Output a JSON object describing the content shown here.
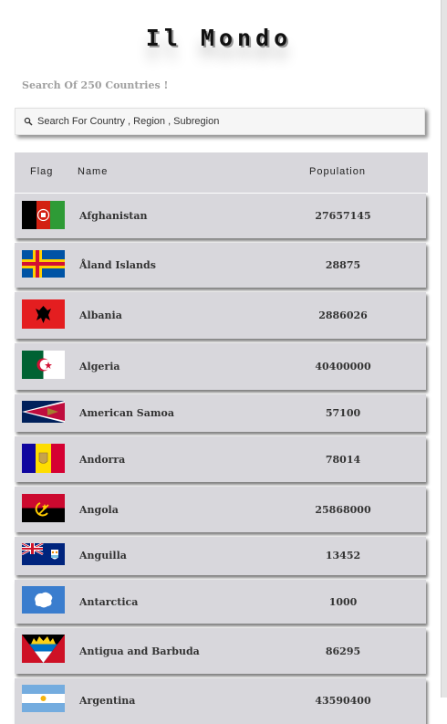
{
  "header": {
    "title": "Il Mondo",
    "subtitle": "Search Of 250 Countries !"
  },
  "search": {
    "placeholder": "Search For Country , Region , Subregion",
    "value": ""
  },
  "table": {
    "columns": [
      "Flag",
      "Name",
      "Population"
    ],
    "rows": [
      {
        "name": "Afghanistan",
        "population": "27657145",
        "flag": "afghanistan-flag"
      },
      {
        "name": "Åland Islands",
        "population": "28875",
        "flag": "aland-flag"
      },
      {
        "name": "Albania",
        "population": "2886026",
        "flag": "albania-flag"
      },
      {
        "name": "Algeria",
        "population": "40400000",
        "flag": "algeria-flag"
      },
      {
        "name": "American Samoa",
        "population": "57100",
        "flag": "american-samoa-flag"
      },
      {
        "name": "Andorra",
        "population": "78014",
        "flag": "andorra-flag"
      },
      {
        "name": "Angola",
        "population": "25868000",
        "flag": "angola-flag"
      },
      {
        "name": "Anguilla",
        "population": "13452",
        "flag": "anguilla-flag"
      },
      {
        "name": "Antarctica",
        "population": "1000",
        "flag": "antarctica-flag"
      },
      {
        "name": "Antigua and Barbuda",
        "population": "86295",
        "flag": "antigua-flag"
      },
      {
        "name": "Argentina",
        "population": "43590400",
        "flag": "argentina-flag"
      }
    ]
  }
}
